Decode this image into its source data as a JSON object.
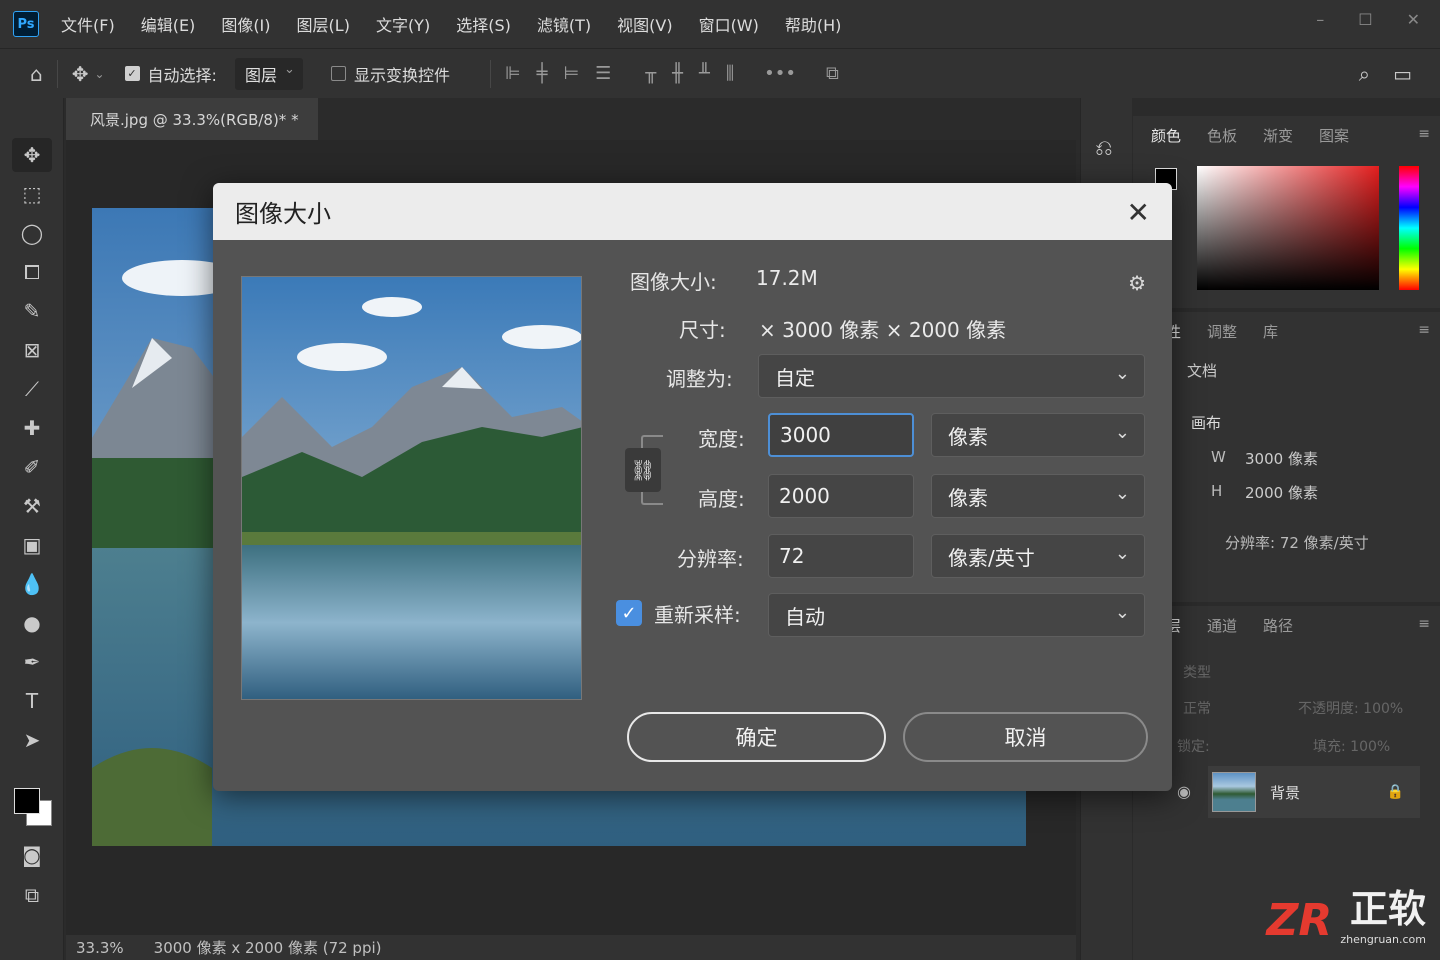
{
  "app": {
    "logo": "Ps"
  },
  "menu": [
    "文件(F)",
    "编辑(E)",
    "图像(I)",
    "图层(L)",
    "文字(Y)",
    "选择(S)",
    "滤镜(T)",
    "视图(V)",
    "窗口(W)",
    "帮助(H)"
  ],
  "options": {
    "auto_select_label": "自动选择:",
    "auto_select_target": "图层",
    "show_transform_label": "显示变换控件"
  },
  "document": {
    "tab_title": "风景.jpg @ 33.3%(RGB/8)* *",
    "zoom": "33.3%",
    "status_info": "3000 像素 x 2000 像素 (72 ppi)"
  },
  "dialog": {
    "title": "图像大小",
    "size_label": "图像大小:",
    "size_value": "17.2M",
    "dims_label": "尺寸:",
    "dims_value": "× 3000 像素 × 2000 像素",
    "fit_label": "调整为:",
    "fit_value": "自定",
    "width_label": "宽度:",
    "width_value": "3000",
    "width_unit": "像素",
    "height_label": "高度:",
    "height_value": "2000",
    "height_unit": "像素",
    "res_label": "分辨率:",
    "res_value": "72",
    "res_unit": "像素/英寸",
    "resample_label": "重新采样:",
    "resample_value": "自动",
    "ok_label": "确定",
    "cancel_label": "取消"
  },
  "color_panel": {
    "tabs": [
      "颜色",
      "色板",
      "渐变",
      "图案"
    ]
  },
  "properties_panel": {
    "tabs": [
      "属性",
      "调整",
      "库"
    ],
    "doc_label": "文档",
    "canvas_label": "画布",
    "w_label": "W",
    "w_value": "3000 像素",
    "h_label": "H",
    "h_value": "2000 像素",
    "resolution": "分辨率: 72 像素/英寸"
  },
  "layers_panel": {
    "tabs": [
      "图层",
      "通道",
      "路径"
    ],
    "filter_label": "类型",
    "blend_mode": "正常",
    "opacity": "不透明度: 100%",
    "lock_label": "锁定:",
    "fill": "填充: 100%",
    "layer_name": "背景"
  },
  "watermark": {
    "logo": "ZR",
    "name": "正软",
    "url": "zhengruan.com"
  }
}
